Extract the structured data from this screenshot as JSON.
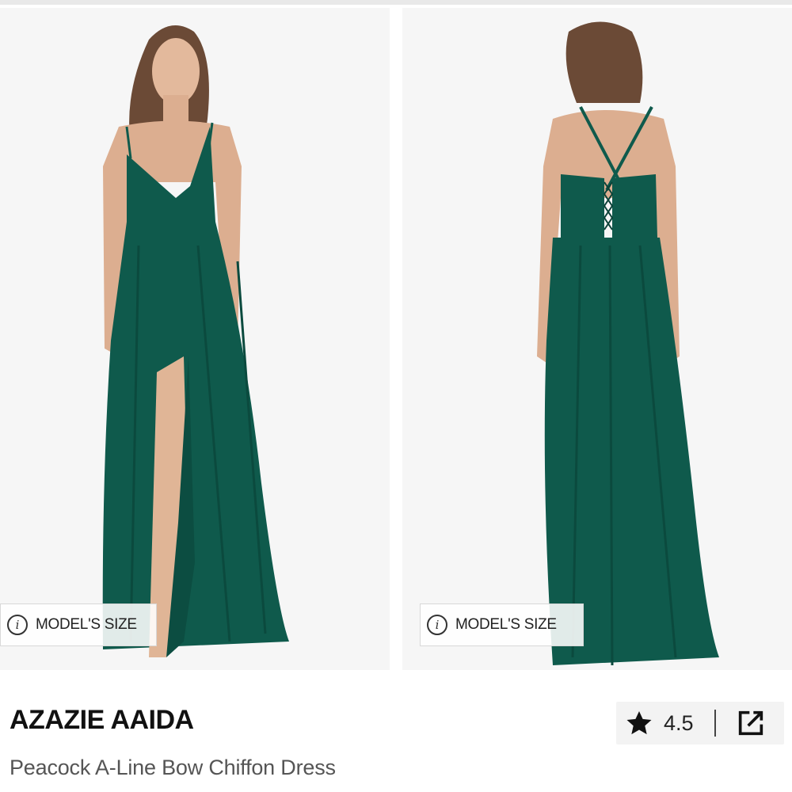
{
  "product": {
    "brand": "AZAZIE AAIDA",
    "name": "Peacock A-Line Bow Chiffon Dress",
    "rating": "4.5"
  },
  "gallery": {
    "model_size_label": "MODEL'S SIZE",
    "info_glyph": "i",
    "dress_color": "#0f5a4c",
    "background_color": "#f6f6f6"
  },
  "icons": {
    "info": "info-icon",
    "rating": "star-icon",
    "share": "external-link-icon"
  }
}
